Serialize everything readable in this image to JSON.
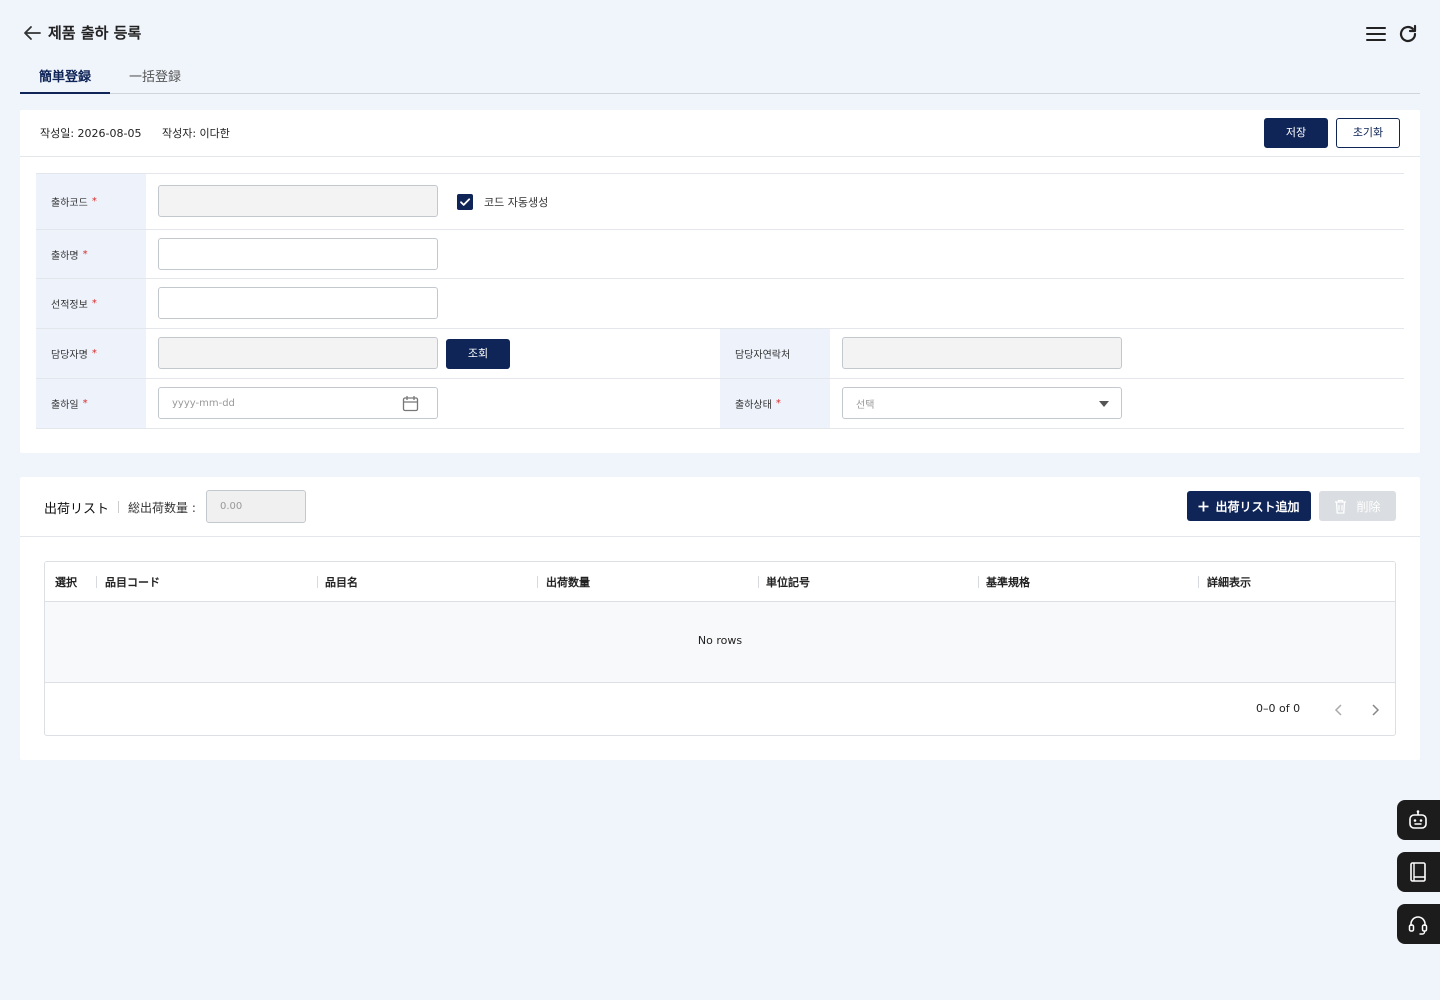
{
  "header": {
    "title": "제품 출하 등록"
  },
  "tabs": [
    {
      "label": "簡単登録"
    },
    {
      "label": "一括登録"
    }
  ],
  "meta": {
    "created": "작성일: 2026-08-05",
    "author": "작성자: 이다한"
  },
  "actions": {
    "save": "저장",
    "reset": "초기화"
  },
  "form": {
    "code_label": "출하코드",
    "auto_code_label": "코드 자동생성",
    "name_label": "출하명",
    "ship_info_label": "선적정보",
    "manager_label": "담당자명",
    "lookup_button": "조회",
    "manager_contact_label": "담당자연락처",
    "date_label": "출하일",
    "date_placeholder": "yyyy-mm-dd",
    "status_label": "출하상태",
    "status_placeholder": "선택",
    "required_mark": "*"
  },
  "list": {
    "title": "出荷リスト",
    "total_label": "総出荷数量 :",
    "total_value": "0.00",
    "add_button": "出荷リスト追加",
    "delete_button": "削除",
    "columns": [
      "選択",
      "品目コード",
      "品目名",
      "出荷数量",
      "単位記号",
      "基準規格",
      "詳細表示"
    ],
    "empty_text": "No rows",
    "pagination": "0–0 of 0"
  },
  "colors": {
    "primary": "#0f2557",
    "required": "#d92b2b",
    "background": "#f0f4fb"
  }
}
